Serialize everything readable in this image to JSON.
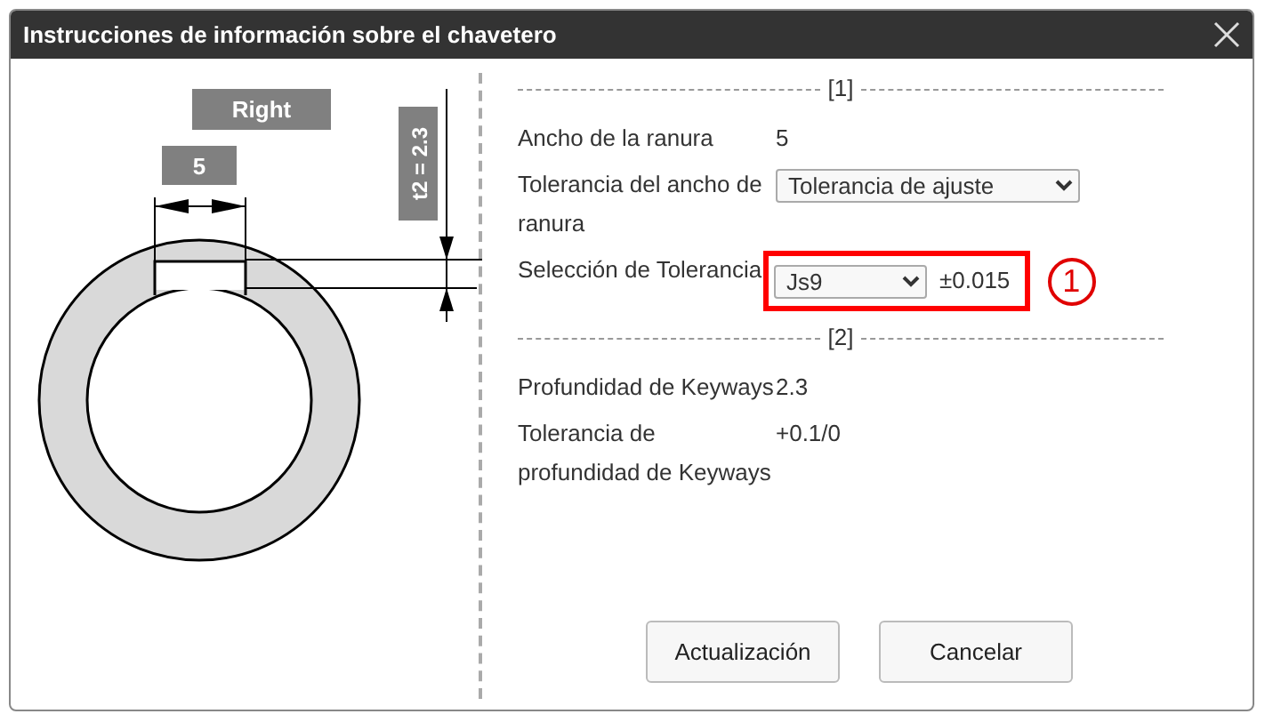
{
  "window": {
    "title": "Instrucciones de información sobre el chavetero"
  },
  "diagram": {
    "position_label": "Right",
    "width_label": "5",
    "depth_label": "t2 = 2.3"
  },
  "sections": [
    {
      "label": "[1]",
      "rows": [
        {
          "kind": "text",
          "label": "Ancho de la ranura",
          "value": "5"
        },
        {
          "kind": "select",
          "label": "Tolerancia del ancho de ranura",
          "value": "Tolerancia de ajuste"
        },
        {
          "kind": "select",
          "label": "Selección de Tolerancia",
          "value": "Js9",
          "reading": "±0.015",
          "highlighted": true,
          "callout": "1"
        }
      ]
    },
    {
      "label": "[2]",
      "rows": [
        {
          "kind": "text",
          "label": "Profundidad de Keyways",
          "value": "2.3"
        },
        {
          "kind": "text",
          "label": "Tolerancia de profundidad de Keyways",
          "value": "+0.1/0"
        }
      ]
    }
  ],
  "buttons": [
    "Actualización",
    "Cancelar"
  ]
}
